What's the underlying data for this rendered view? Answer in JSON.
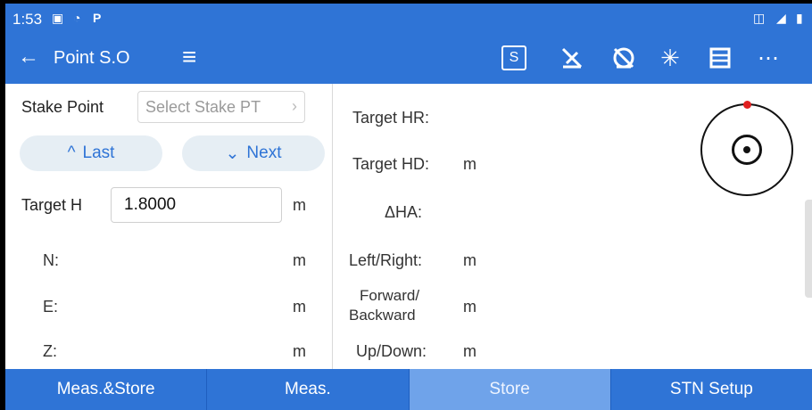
{
  "status": {
    "time": "1:53"
  },
  "header": {
    "title": "Point S.O",
    "s_label": "S"
  },
  "left": {
    "stake_label": "Stake Point",
    "stake_select_placeholder": "Select Stake PT",
    "last_label": "Last",
    "next_label": "Next",
    "target_h_label": "Target H",
    "target_h_value": "1.8000",
    "unit": "m",
    "n_label": "N:",
    "e_label": "E:",
    "z_label": "Z:"
  },
  "right": {
    "target_hr_label": "Target HR:",
    "target_hd_label": "Target HD:",
    "target_hd_unit": "m",
    "delta_ha_label": "ΔHA:",
    "left_right_label": "Left/Right:",
    "left_right_unit": "m",
    "forward_label_1": "Forward/",
    "forward_label_2": "Backward",
    "forward_unit": "m",
    "up_down_label": "Up/Down:",
    "up_down_unit": "m"
  },
  "bottom": {
    "meas_store": "Meas.&Store",
    "meas": "Meas.",
    "store": "Store",
    "stn_setup": "STN Setup"
  },
  "colors": {
    "primary": "#2f74d6",
    "store_disabled": "#6fa3ea",
    "compass_marker": "#e02020"
  },
  "icons": [
    "back-arrow-icon",
    "hamburger-menu-icon",
    "s-box-icon",
    "laser-off-icon",
    "prism-off-icon",
    "laser-plummet-icon",
    "data-list-icon",
    "more-icon"
  ]
}
